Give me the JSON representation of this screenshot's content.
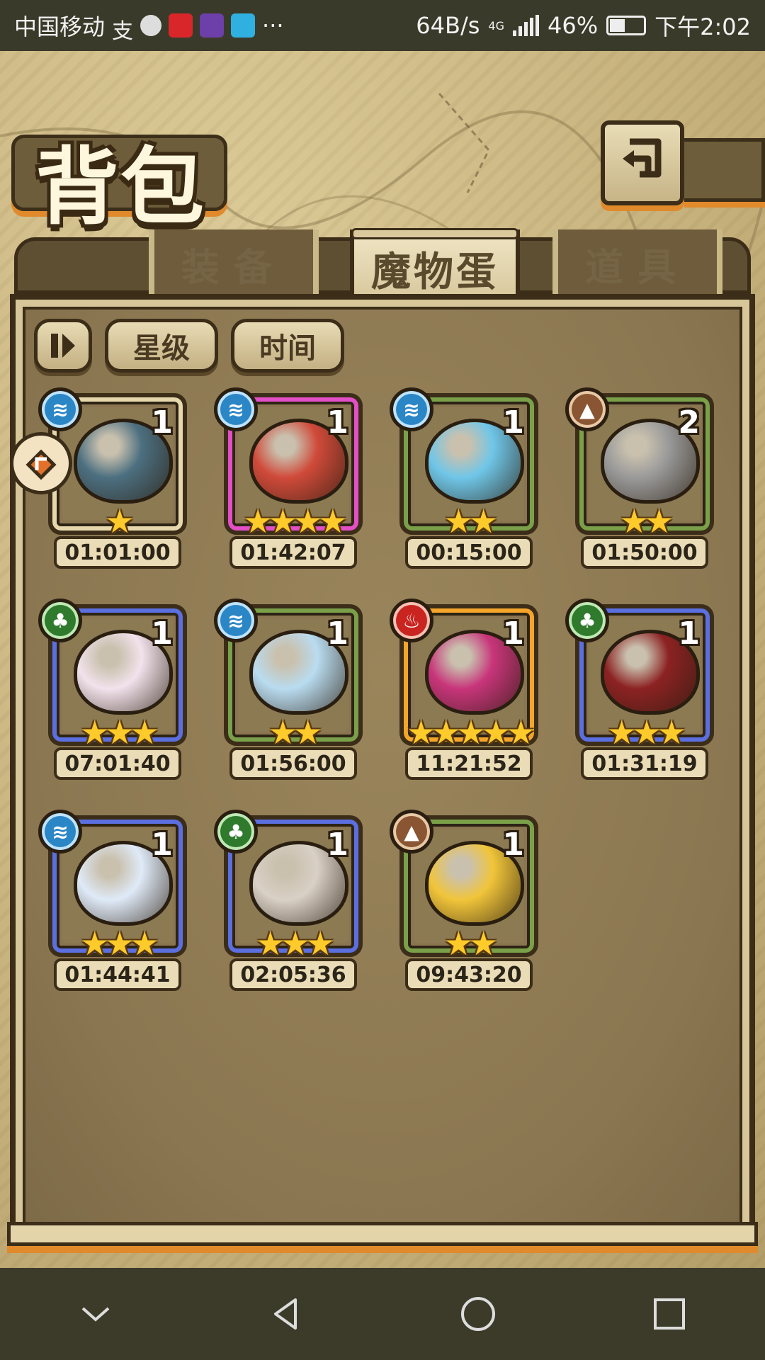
{
  "status_bar": {
    "carrier": "中国移动",
    "net_speed": "64B/s",
    "network": "4G",
    "battery": "46%",
    "battery_level": 0.46,
    "time": "下午2:02",
    "more": "···"
  },
  "header": {
    "title": "背包",
    "back_icon": "return-arrow-icon"
  },
  "tabs": [
    {
      "label": "装备",
      "active": false
    },
    {
      "label": "魔物蛋",
      "active": true
    },
    {
      "label": "道具",
      "active": false
    }
  ],
  "sort": {
    "toggle_icon": "sort-toggle-icon",
    "by_star": "星级",
    "by_time": "时间"
  },
  "items": [
    {
      "element": "water",
      "count": "1",
      "stars": 1,
      "timer": "01:01:00",
      "rim": "#e6d7ac",
      "egg": "#4c6f80"
    },
    {
      "element": "water",
      "count": "1",
      "stars": 4,
      "timer": "01:42:07",
      "rim": "#e44fc8",
      "egg": "#d04a3a"
    },
    {
      "element": "water",
      "count": "1",
      "stars": 2,
      "timer": "00:15:00",
      "rim": "#7aa04a",
      "egg": "#6fc6e8"
    },
    {
      "element": "earth",
      "count": "2",
      "stars": 2,
      "timer": "01:50:00",
      "rim": "#7aa04a",
      "egg": "#9a9a9a"
    },
    {
      "element": "grass",
      "count": "1",
      "stars": 3,
      "timer": "07:01:40",
      "rim": "#5b6fe0",
      "egg": "#f2e2ec"
    },
    {
      "element": "water",
      "count": "1",
      "stars": 2,
      "timer": "01:56:00",
      "rim": "#7aa04a",
      "egg": "#b9dcf0"
    },
    {
      "element": "fire",
      "count": "1",
      "stars": 5,
      "timer": "11:21:52",
      "rim": "#f4a52a",
      "egg": "#c8357a"
    },
    {
      "element": "grass",
      "count": "1",
      "stars": 3,
      "timer": "01:31:19",
      "rim": "#5b6fe0",
      "egg": "#8c2222"
    },
    {
      "element": "water",
      "count": "1",
      "stars": 3,
      "timer": "01:44:41",
      "rim": "#5b6fe0",
      "egg": "#dfeaf8"
    },
    {
      "element": "grass",
      "count": "1",
      "stars": 3,
      "timer": "02:05:36",
      "rim": "#5b6fe0",
      "egg": "#d9d0c6"
    },
    {
      "element": "earth",
      "count": "1",
      "stars": 2,
      "timer": "09:43:20",
      "rim": "#7aa04a",
      "egg": "#f1c53a"
    }
  ],
  "nav": [
    "chevron-down-icon",
    "back-triangle-icon",
    "home-circle-icon",
    "recents-square-icon"
  ]
}
